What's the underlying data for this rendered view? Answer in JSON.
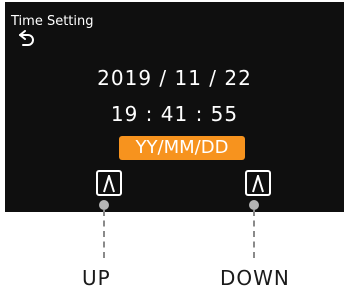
{
  "screen": {
    "title": "Time Setting",
    "date": "2019 / 11 / 22",
    "time": "19 : 41 : 55",
    "format_badge": "YY/MM/DD",
    "accent_color": "#f7931e",
    "back_icon": "return-arrow-icon",
    "up_icon": "caret-up-icon",
    "down_icon": "caret-up-icon"
  },
  "callouts": {
    "up_label": "UP",
    "down_label": "DOWN"
  }
}
